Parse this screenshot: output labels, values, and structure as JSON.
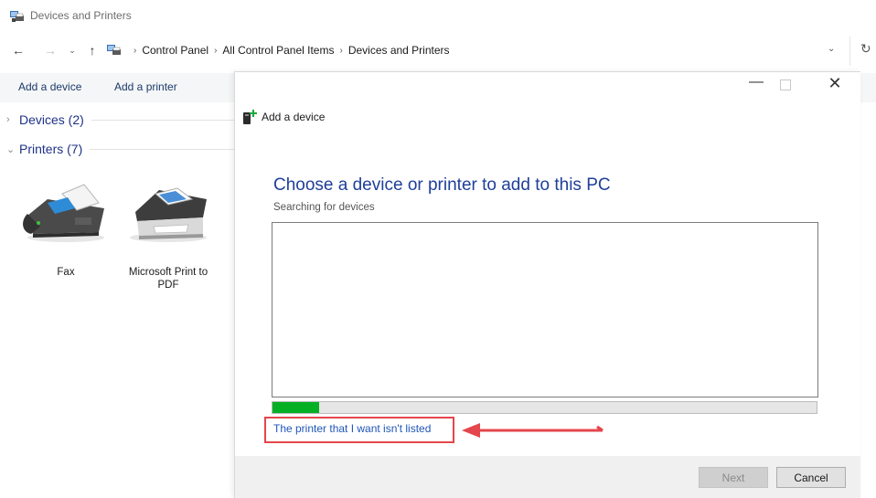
{
  "window": {
    "title": "Devices and Printers"
  },
  "nav": {
    "back": "←",
    "forward": "→",
    "recent": "⌄",
    "up": "↑",
    "dropdown": "⌄",
    "refresh": "↻",
    "breadcrumb": [
      "Control Panel",
      "All Control Panel Items",
      "Devices and Printers"
    ],
    "separator": "›"
  },
  "commands": {
    "add_device": "Add a device",
    "add_printer": "Add a printer"
  },
  "groups": {
    "devices": {
      "label": "Devices (2)",
      "chevron": "›"
    },
    "printers": {
      "label": "Printers (7)",
      "chevron": "⌄"
    }
  },
  "tiles": {
    "fax": "Fax",
    "pdf": "Microsoft Print to PDF"
  },
  "dialog": {
    "minimize": "—",
    "close": "✕",
    "header_title": "Add a device",
    "heading": "Choose a device or printer to add to this PC",
    "status": "Searching for devices",
    "progress_percent": 8.5,
    "link": "The printer that I want isn't listed",
    "next_label": "Next",
    "cancel_label": "Cancel"
  },
  "colors": {
    "accent_blue": "#1f3f9a",
    "link_blue": "#1f56b8",
    "progress_green": "#06b025",
    "annotation_red": "#e5454c"
  }
}
